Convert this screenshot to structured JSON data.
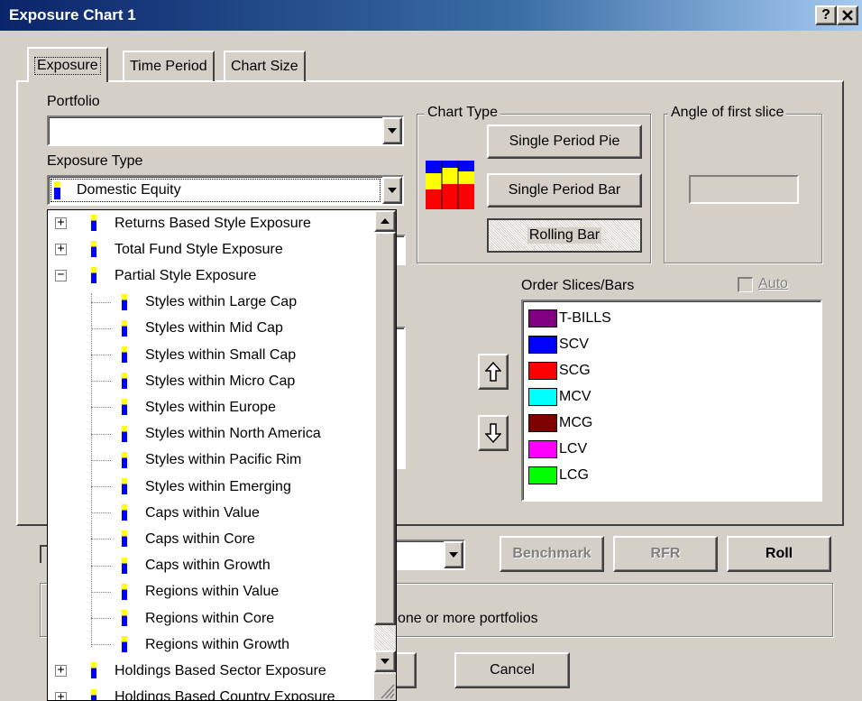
{
  "window": {
    "title": "Exposure Chart 1",
    "help_label": "?",
    "close_label": "✕"
  },
  "tabs": [
    {
      "label": "Exposure",
      "active": true
    },
    {
      "label": "Time Period",
      "active": false
    },
    {
      "label": "Chart Size",
      "active": false
    }
  ],
  "portfolio": {
    "label": "Portfolio",
    "value": ""
  },
  "exposure_type": {
    "label": "Exposure Type",
    "value": "Domestic Equity"
  },
  "tree": {
    "items": [
      {
        "label": "Returns Based Style Exposure",
        "expander": "+"
      },
      {
        "label": "Total Fund Style Exposure",
        "expander": "+"
      },
      {
        "label": "Partial Style Exposure",
        "expander": "-"
      },
      {
        "label": "Styles within Large Cap"
      },
      {
        "label": "Styles within Mid Cap"
      },
      {
        "label": "Styles within Small Cap"
      },
      {
        "label": "Styles within Micro Cap"
      },
      {
        "label": "Styles within Europe"
      },
      {
        "label": "Styles within North America"
      },
      {
        "label": "Styles within Pacific Rim"
      },
      {
        "label": "Styles within Emerging"
      },
      {
        "label": "Caps within Value"
      },
      {
        "label": "Caps within Core"
      },
      {
        "label": "Caps within Growth"
      },
      {
        "label": "Regions within Value"
      },
      {
        "label": "Regions within Core"
      },
      {
        "label": "Regions within Growth"
      },
      {
        "label": "Holdings Based Sector Exposure",
        "expander": "+"
      },
      {
        "label": "Holdings Based Country Exposure",
        "expander": "+"
      }
    ]
  },
  "chart_type": {
    "label": "Chart Type",
    "pie_button": "Single Period Pie",
    "bar_button": "Single Period Bar",
    "rolling_button": "Rolling Bar"
  },
  "angle": {
    "label": "Angle of first slice",
    "value": ""
  },
  "order": {
    "label": "Order Slices/Bars",
    "auto_label": "Auto",
    "items": [
      {
        "label": "T-BILLS",
        "color": "#800080"
      },
      {
        "label": "SCV",
        "color": "#0000ff"
      },
      {
        "label": "SCG",
        "color": "#ff0000"
      },
      {
        "label": "MCV",
        "color": "#00ffff"
      },
      {
        "label": "MCG",
        "color": "#800000"
      },
      {
        "label": "LCV",
        "color": "#ff00ff"
      },
      {
        "label": "LCG",
        "color": "#00ff00"
      }
    ]
  },
  "buttons": {
    "benchmark": "Benchmark",
    "rfr": "RFR",
    "roll": "Roll",
    "cancel": "Cancel"
  },
  "status_message": "one or more portfolios"
}
